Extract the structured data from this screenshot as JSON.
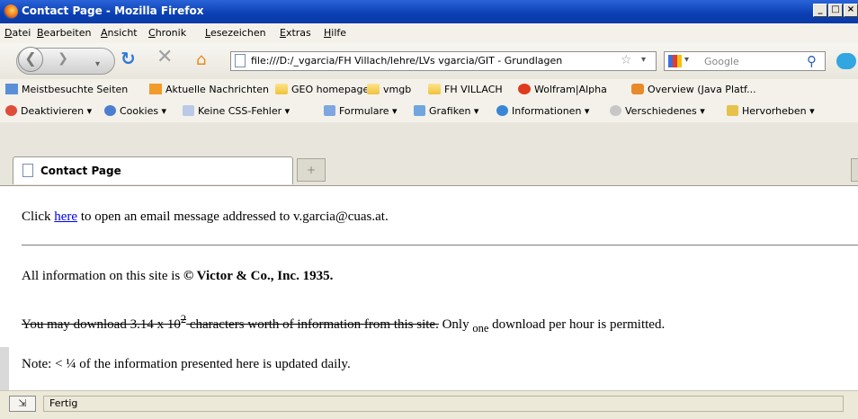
{
  "window": {
    "title": "Contact Page - Mozilla Firefox"
  },
  "menu": [
    "Datei",
    "Bearbeiten",
    "Ansicht",
    "Chronik",
    "Lesezeichen",
    "Extras",
    "Hilfe"
  ],
  "nav": {
    "url": "file:///D:/_vgarcia/FH Villach/lehre/LVs vgarcia/GIT - Grundlagen",
    "search_placeholder": "Google"
  },
  "bookmarks": [
    "Meistbesuchte Seiten",
    "Aktuelle Nachrichten",
    "GEO homepage",
    "vmgb",
    "FH VILLACH",
    "Wolfram|Alpha",
    "Overview (Java Platf..."
  ],
  "webdev": [
    "Deaktivieren ▾",
    "Cookies ▾",
    "Keine CSS-Fehler ▾",
    "Formulare ▾",
    "Grafiken ▾",
    "Informationen ▾",
    "Verschiedenes ▾",
    "Hervorheben ▾"
  ],
  "tab": {
    "label": "Contact Page",
    "newtab": "+"
  },
  "page": {
    "l1_pre": "Click ",
    "l1_link": "here",
    "l1_post": " to open an email message addressed to v.garcia@cuas.at.",
    "l2_pre": "All information on this site is ",
    "l2_bold": "© Victor & Co., Inc. 1935.",
    "l3_strike_pre": "You may download 3.14 x 10",
    "l3_sup": "2",
    "l3_strike_post": " characters worth of information from this site.",
    "l3_mid": " Only ",
    "l3_sub": "one",
    "l3_end": " download per hour is permitted.",
    "l4": "Note: < ¼ of the information presented here is updated daily."
  },
  "status": {
    "text": "Fertig"
  }
}
